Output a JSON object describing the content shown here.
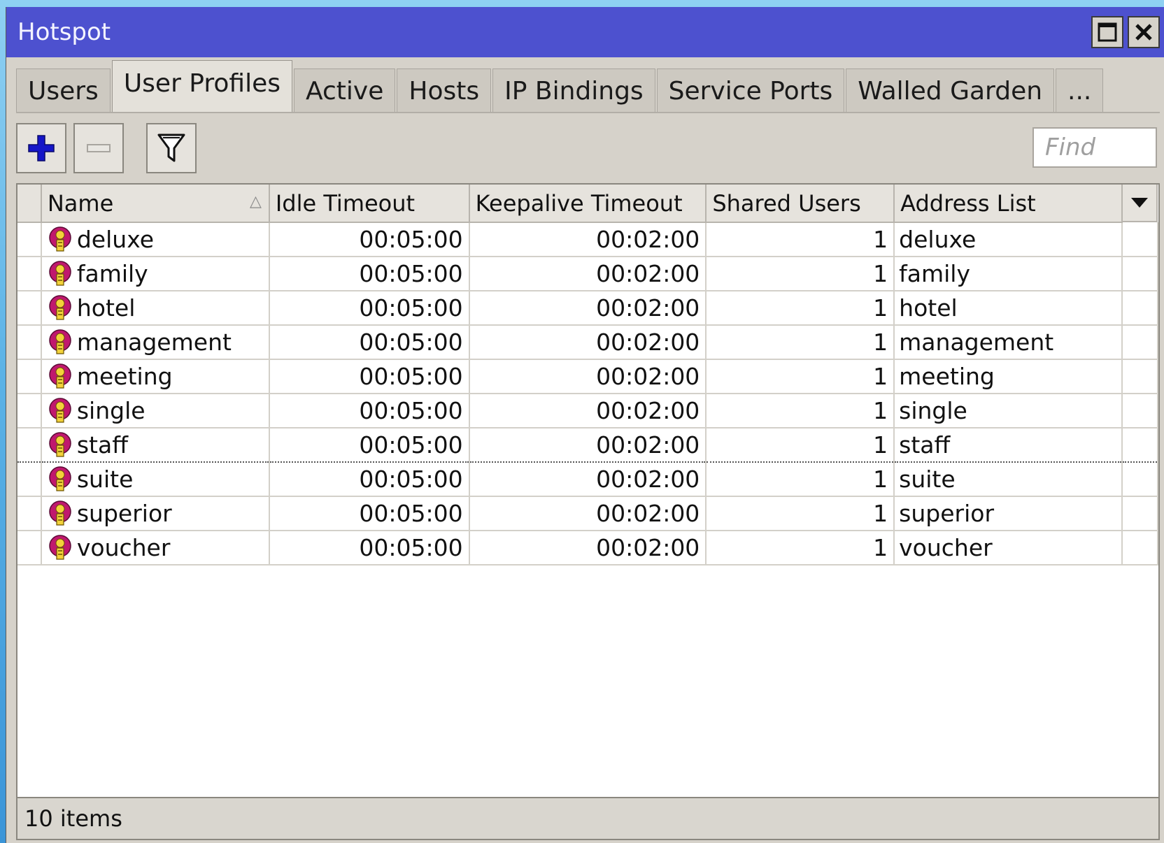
{
  "window": {
    "title": "Hotspot"
  },
  "tabs": [
    {
      "label": "Users"
    },
    {
      "label": "User Profiles",
      "active": true
    },
    {
      "label": "Active"
    },
    {
      "label": "Hosts"
    },
    {
      "label": "IP Bindings"
    },
    {
      "label": "Service Ports"
    },
    {
      "label": "Walled Garden"
    },
    {
      "label": "..."
    }
  ],
  "toolbar": {
    "find_placeholder": "Find"
  },
  "table": {
    "columns": [
      "Name",
      "Idle Timeout",
      "Keepalive Timeout",
      "Shared Users",
      "Address List"
    ],
    "sorted_column": "Name",
    "rows": [
      {
        "name": "deluxe",
        "idle": "00:05:00",
        "keepalive": "00:02:00",
        "shared": "1",
        "address": "deluxe"
      },
      {
        "name": "family",
        "idle": "00:05:00",
        "keepalive": "00:02:00",
        "shared": "1",
        "address": "family"
      },
      {
        "name": "hotel",
        "idle": "00:05:00",
        "keepalive": "00:02:00",
        "shared": "1",
        "address": "hotel"
      },
      {
        "name": "management",
        "idle": "00:05:00",
        "keepalive": "00:02:00",
        "shared": "1",
        "address": "management"
      },
      {
        "name": "meeting",
        "idle": "00:05:00",
        "keepalive": "00:02:00",
        "shared": "1",
        "address": "meeting"
      },
      {
        "name": "single",
        "idle": "00:05:00",
        "keepalive": "00:02:00",
        "shared": "1",
        "address": "single"
      },
      {
        "name": "staff",
        "idle": "00:05:00",
        "keepalive": "00:02:00",
        "shared": "1",
        "address": "staff",
        "selected": true
      },
      {
        "name": "suite",
        "idle": "00:05:00",
        "keepalive": "00:02:00",
        "shared": "1",
        "address": "suite"
      },
      {
        "name": "superior",
        "idle": "00:05:00",
        "keepalive": "00:02:00",
        "shared": "1",
        "address": "superior"
      },
      {
        "name": "voucher",
        "idle": "00:05:00",
        "keepalive": "00:02:00",
        "shared": "1",
        "address": "voucher"
      }
    ]
  },
  "status": {
    "item_count": "10 items"
  },
  "colors": {
    "titlebar": "#4d51cf",
    "window_bg": "#d6d2ca",
    "add_icon": "#1515c8",
    "profile_icon": "#c0186e"
  },
  "icons": {
    "add": "plus-icon",
    "remove": "minus-icon",
    "filter": "funnel-icon",
    "profile": "user-profile-icon",
    "maximize": "maximize-icon",
    "close": "close-icon",
    "column_menu": "chevron-down-icon"
  }
}
